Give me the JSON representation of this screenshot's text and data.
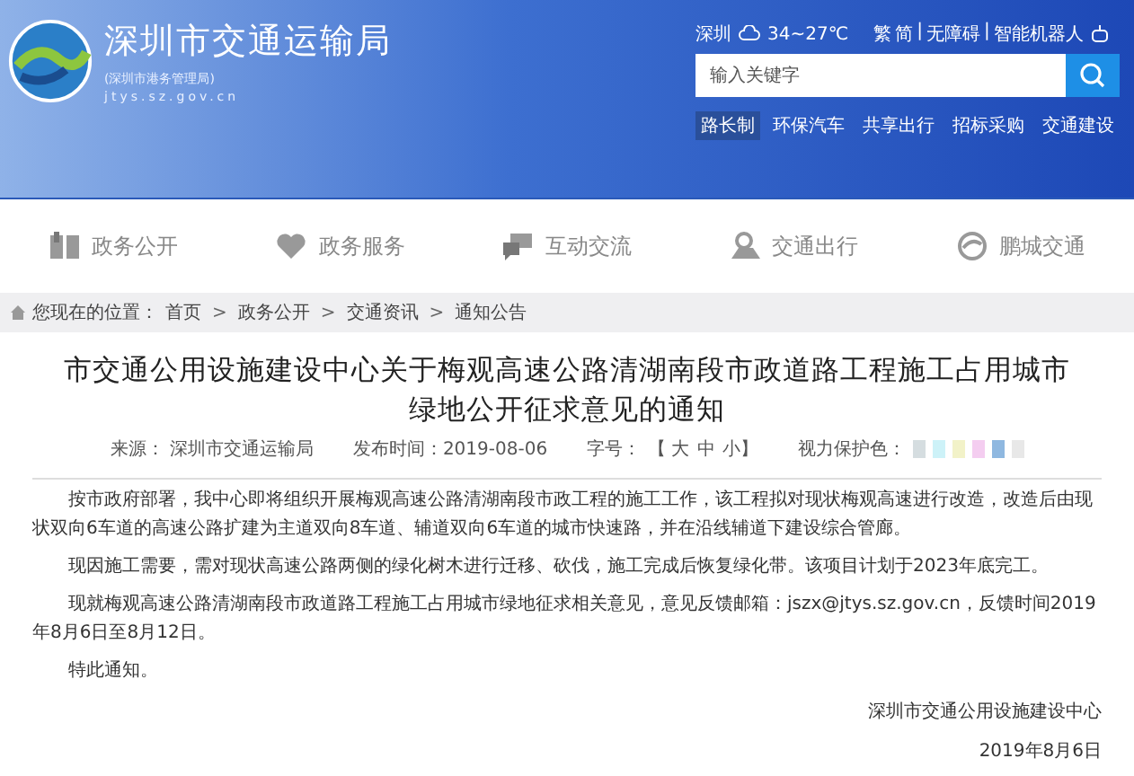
{
  "header": {
    "title": "深圳市交通运输局",
    "subtitle": "(深圳市港务管理局)",
    "url": "jtys.sz.gov.cn",
    "city": "深圳",
    "weather": "34~27℃",
    "links": [
      "繁",
      "简",
      "无障碍",
      "智能机器人"
    ],
    "link_separator": "|",
    "search": {
      "placeholder": "输入关键字"
    },
    "quick_links": [
      {
        "label": "路长制",
        "selected": true
      },
      {
        "label": "环保汽车",
        "selected": false
      },
      {
        "label": "共享出行",
        "selected": false
      },
      {
        "label": "招标采购",
        "selected": false
      },
      {
        "label": "交通建设",
        "selected": false
      }
    ]
  },
  "nav": [
    {
      "label": "政务公开",
      "kind": "book"
    },
    {
      "label": "政务服务",
      "kind": "heart"
    },
    {
      "label": "互动交流",
      "kind": "chat"
    },
    {
      "label": "交通出行",
      "kind": "map"
    },
    {
      "label": "鹏城交通",
      "kind": "logo"
    }
  ],
  "breadcrumb": {
    "prefix": "您现在的位置：",
    "items": [
      "首页",
      "政务公开",
      "交通资讯",
      "通知公告"
    ],
    "separator": ">"
  },
  "article": {
    "title": "市交通公用设施建设中心关于梅观高速公路清湖南段市政道路工程施工占用城市绿地公开征求意见的通知",
    "source": "来源：  深圳市交通运输局",
    "date": "发布时间：2019-08-06",
    "font_label": "字号：",
    "font_sizes": [
      "【 大",
      "中",
      "小】"
    ],
    "color_label": "视力保护色：",
    "colors": [
      {
        "color": "#d5dde0"
      },
      {
        "color": "#cdf2f8"
      },
      {
        "color": "#f2f2c8"
      },
      {
        "color": "#f4cdf0"
      },
      {
        "color": "#8fb8e0"
      },
      {
        "color": "#e8e8e8"
      }
    ],
    "paragraphs": [
      "按市政府部署，我中心即将组织开展梅观高速公路清湖南段市政工程的施工工作，该工程拟对现状梅观高速进行改造，改造后由现状双向6车道的高速公路扩建为主道双向8车道、辅道双向6车道的城市快速路，并在沿线辅道下建设综合管廊。",
      "现因施工需要，需对现状高速公路两侧的绿化树木进行迁移、砍伐，施工完成后恢复绿化带。该项目计划于2023年底完工。",
      "现就梅观高速公路清湖南段市政道路工程施工占用城市绿地征求相关意见，意见反馈邮箱：jszx@jtys.sz.gov.cn，反馈时间2019年8月6日至8月12日。",
      "特此通知。"
    ],
    "signature": "深圳市交通公用设施建设中心",
    "signature_date": "2019年8月6日"
  }
}
